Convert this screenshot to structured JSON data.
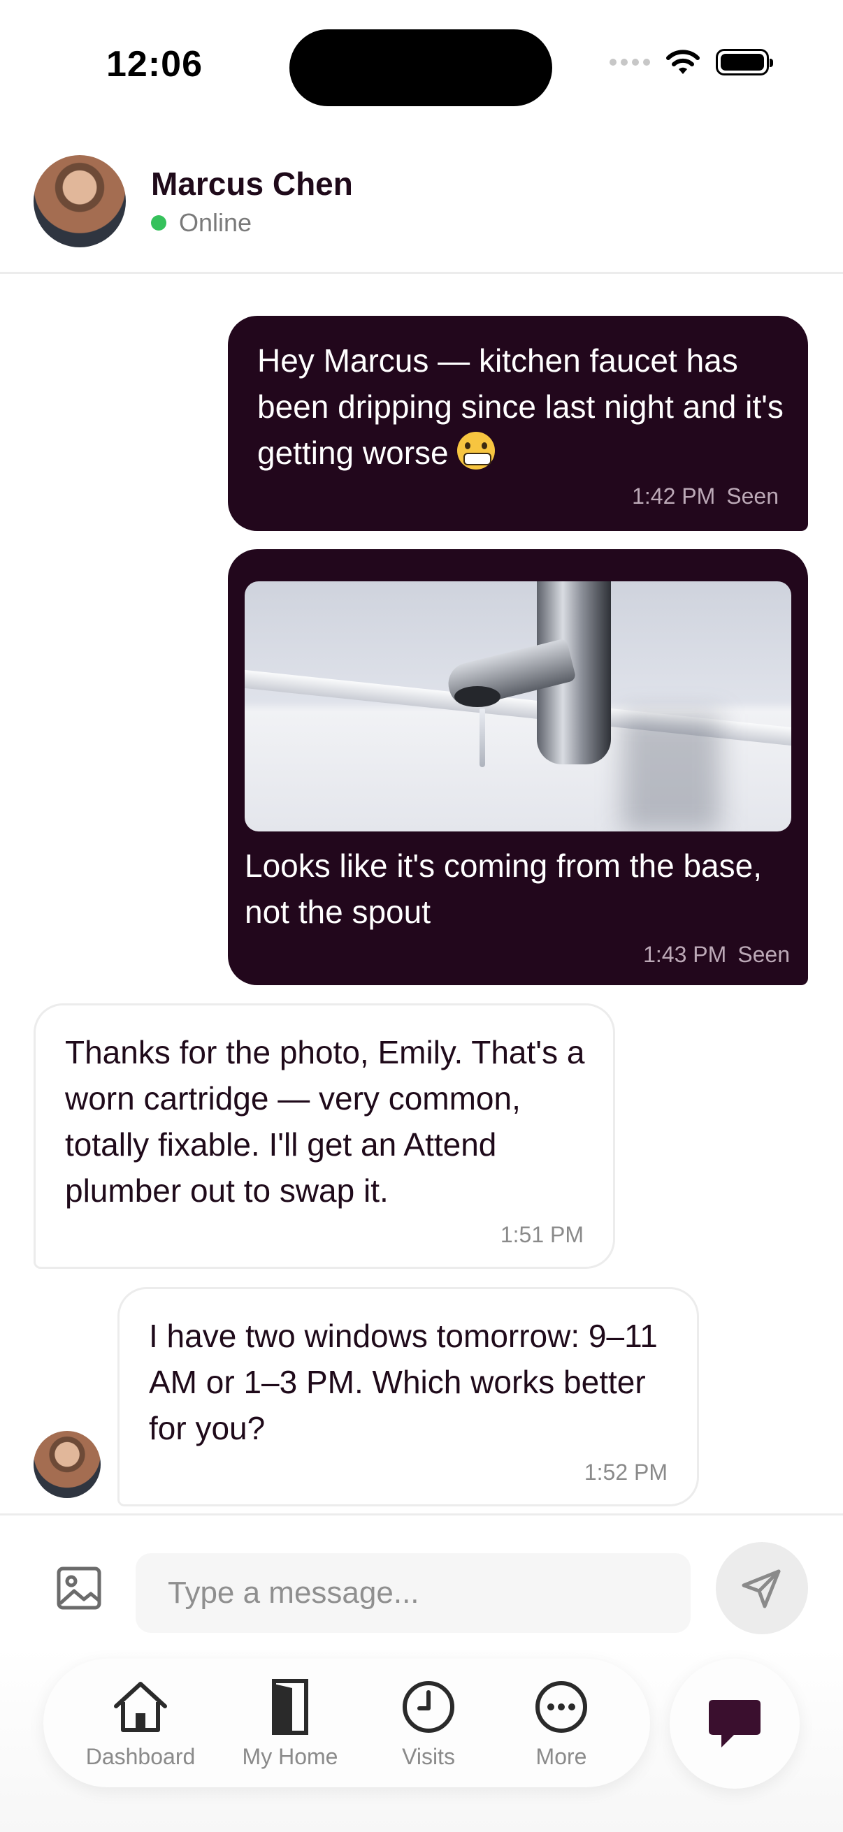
{
  "status_bar": {
    "time": "12:06"
  },
  "header": {
    "contact_name": "Marcus Chen",
    "presence": "Online",
    "presence_color": "#35c15b"
  },
  "messages": [
    {
      "direction": "outgoing",
      "text": "Hey Marcus — kitchen faucet has been dripping since last night and it's getting worse",
      "emoji": "grimacing-face",
      "time": "1:42 PM",
      "status": "Seen"
    },
    {
      "direction": "outgoing",
      "image": "dripping-faucet-photo",
      "text": "Looks like it's coming from the base, not the spout",
      "time": "1:43 PM",
      "status": "Seen"
    },
    {
      "direction": "incoming",
      "text": "Thanks for the photo, Emily. That's a worn cartridge — very common, totally fixable. I'll get an Attend plumber out to swap it.",
      "time": "1:51 PM"
    },
    {
      "direction": "incoming",
      "text": "I have two windows tomorrow: 9–11 AM or 1–3 PM. Which works better for you?",
      "time": "1:52 PM"
    }
  ],
  "composer": {
    "placeholder": "Type a message..."
  },
  "nav": {
    "items": [
      {
        "label": "Dashboard",
        "icon": "house-icon"
      },
      {
        "label": "My Home",
        "icon": "door-icon"
      },
      {
        "label": "Visits",
        "icon": "clock-icon"
      },
      {
        "label": "More",
        "icon": "ellipsis-icon"
      }
    ],
    "active": "chat-bubble-icon"
  },
  "colors": {
    "accent": "#22071c",
    "outgoing_bubble": "#22071c",
    "incoming_border": "#ececec"
  }
}
